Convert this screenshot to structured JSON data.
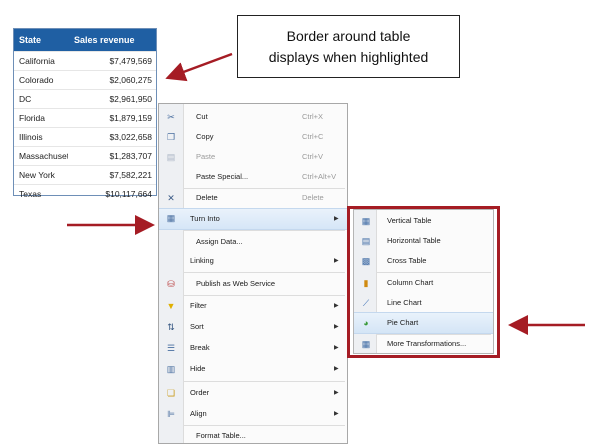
{
  "table": {
    "headers": [
      "State",
      "Sales revenue"
    ],
    "rows": [
      [
        "California",
        "$7,479,569"
      ],
      [
        "Colorado",
        "$2,060,275"
      ],
      [
        "DC",
        "$2,961,950"
      ],
      [
        "Florida",
        "$1,879,159"
      ],
      [
        "Illinois",
        "$3,022,658"
      ],
      [
        "Massachuset",
        "$1,283,707"
      ],
      [
        "New York",
        "$7,582,221"
      ],
      [
        "Texas",
        "$10,117,664"
      ]
    ]
  },
  "callout": {
    "line1": "Border around table",
    "line2": "displays when highlighted"
  },
  "context_menu": {
    "items": [
      {
        "label": "Cut",
        "shortcut": "Ctrl+X",
        "icon": "scissors-icon"
      },
      {
        "label": "Copy",
        "shortcut": "Ctrl+C",
        "icon": "copy-icon"
      },
      {
        "label": "Paste",
        "shortcut": "Ctrl+V",
        "icon": "paste-icon",
        "disabled": true
      },
      {
        "label": "Paste Special...",
        "shortcut": "Ctrl+Alt+V"
      },
      {
        "label": "Delete",
        "shortcut": "Delete",
        "icon": "delete-x-icon"
      },
      {
        "label": "Turn Into",
        "submenu": true,
        "icon": "turn-into-icon"
      },
      {
        "label": "Assign Data..."
      },
      {
        "label": "Linking",
        "submenu": true
      },
      {
        "label": "Publish as Web Service",
        "icon": "web-service-icon"
      },
      {
        "label": "Filter",
        "submenu": true,
        "icon": "filter-icon"
      },
      {
        "label": "Sort",
        "submenu": true,
        "icon": "sort-icon"
      },
      {
        "label": "Break",
        "submenu": true,
        "icon": "break-icon"
      },
      {
        "label": "Hide",
        "submenu": true,
        "icon": "hide-icon"
      },
      {
        "label": "Order",
        "submenu": true,
        "icon": "order-icon"
      },
      {
        "label": "Align",
        "submenu": true,
        "icon": "align-icon"
      },
      {
        "label": "Format Table..."
      }
    ]
  },
  "turn_into_submenu": {
    "items": [
      {
        "label": "Vertical Table",
        "icon": "vertical-table-icon"
      },
      {
        "label": "Horizontal Table",
        "icon": "horizontal-table-icon"
      },
      {
        "label": "Cross Table",
        "icon": "cross-table-icon"
      },
      {
        "label": "Column Chart",
        "icon": "column-chart-icon"
      },
      {
        "label": "Line Chart",
        "icon": "line-chart-icon"
      },
      {
        "label": "Pie Chart",
        "icon": "pie-chart-icon",
        "highlighted": true
      },
      {
        "label": "More Transformations...",
        "icon": "more-transformations-icon"
      }
    ]
  },
  "colors": {
    "table_header": "#1f5fa3",
    "arrow": "#a51c24",
    "highlight_frame": "#a51c24"
  }
}
